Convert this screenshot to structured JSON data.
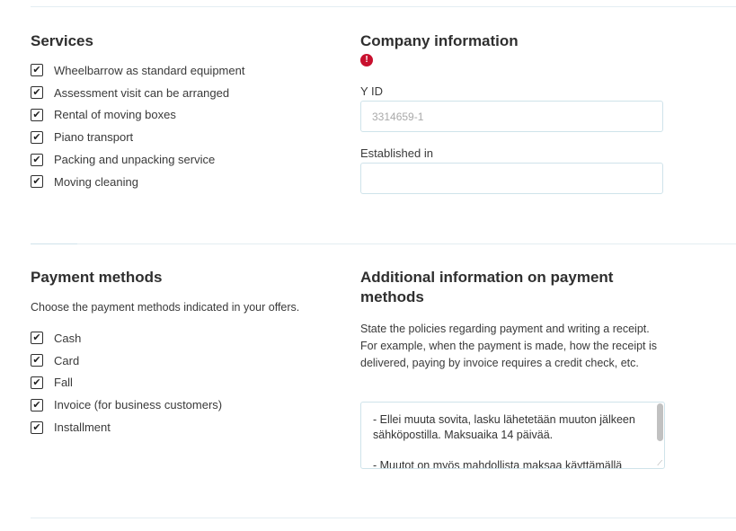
{
  "services": {
    "title": "Services",
    "items": [
      {
        "label": "Wheelbarrow as standard equipment",
        "checked": true
      },
      {
        "label": "Assessment visit can be arranged",
        "checked": true
      },
      {
        "label": "Rental of moving boxes",
        "checked": true
      },
      {
        "label": "Piano transport",
        "checked": true
      },
      {
        "label": "Packing and unpacking service",
        "checked": true
      },
      {
        "label": "Moving cleaning",
        "checked": true
      }
    ]
  },
  "company": {
    "title": "Company information",
    "error_icon": "!",
    "yid_label": "Y ID",
    "yid_placeholder": "3314659-1",
    "established_label": "Established in",
    "established_value": ""
  },
  "payment": {
    "title": "Payment methods",
    "description": "Choose the payment methods indicated in your offers.",
    "items": [
      {
        "label": "Cash",
        "checked": true
      },
      {
        "label": "Card",
        "checked": true
      },
      {
        "label": "Fall",
        "checked": true
      },
      {
        "label": "Invoice (for business customers)",
        "checked": true
      },
      {
        "label": "Installment",
        "checked": true
      }
    ]
  },
  "additional": {
    "title": "Additional information on payment methods",
    "description": "State the policies regarding payment and writing a receipt. For example, when the payment is made, how the receipt is delivered, paying by invoice requires a credit check, etc.",
    "textarea_value": "- Ellei muuta sovita, lasku lähetetään muuton jälkeen sähköpostilla. Maksuaika 14 päivää.\n\n- Muutot on myös mahdollista maksaa käyttämällä"
  },
  "checkmark_glyph": "✔",
  "colors": {
    "border": "#cfe3ea",
    "divider": "#e3edf2",
    "error": "#c8102e"
  }
}
